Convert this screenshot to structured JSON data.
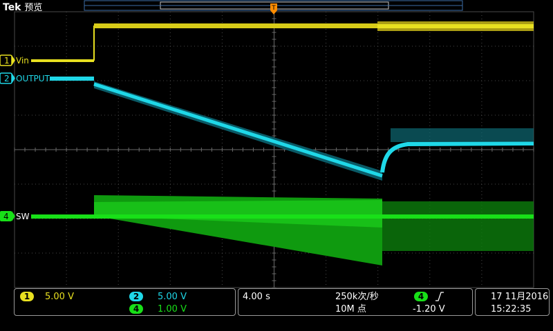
{
  "header": {
    "brand": "Tek",
    "mode": "预览"
  },
  "channels": [
    {
      "id": "1",
      "label": "Vin",
      "color": "#e8e020",
      "scale": "5.00 V"
    },
    {
      "id": "2",
      "label": "OUTPUT",
      "color": "#1fd8e8",
      "scale": "5.00 V"
    },
    {
      "id": "4",
      "label": "SW",
      "color": "#18e018",
      "scale": "1.00 V"
    }
  ],
  "timebase": {
    "scale": "4.00 s",
    "sample_rate": "250k次/秒",
    "record_length": "10M 点"
  },
  "trigger": {
    "channel": "4",
    "slope_icon": "rising-edge-icon",
    "level": "-1.20 V",
    "marker": "T"
  },
  "datetime": {
    "date": "17 11月2016",
    "time": "15:22:35"
  },
  "colors": {
    "grid": "#4a4a4a",
    "background": "#000000",
    "trigger_marker": "#ff8c00"
  }
}
